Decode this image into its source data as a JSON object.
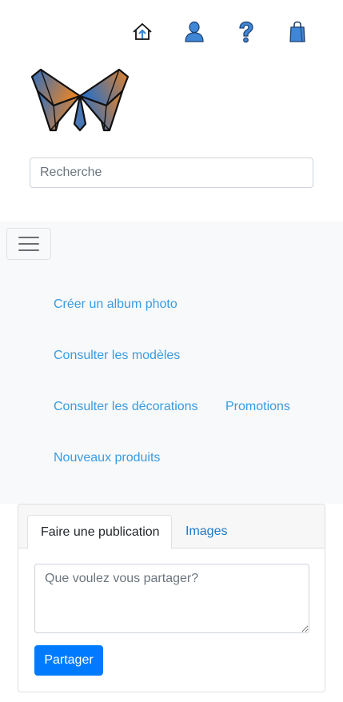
{
  "header": {
    "icons": [
      "home-upload-icon",
      "user-icon",
      "help-icon",
      "shopping-bag-icon"
    ]
  },
  "brand": {
    "logo": "butterfly-logo",
    "colors": {
      "blue": "#2f6fc0",
      "orange": "#e3832a"
    }
  },
  "search": {
    "placeholder": "Recherche",
    "value": ""
  },
  "nav": {
    "toggler_icon": "hamburger-icon",
    "items": [
      {
        "label": "Créer un album photo"
      },
      {
        "label": "Consulter les modèles"
      },
      {
        "label": "Consulter les décorations"
      },
      {
        "label": "Promotions"
      },
      {
        "label": "Nouveaux produits"
      }
    ],
    "link_color": "#3a9be0"
  },
  "composer": {
    "tabs": [
      {
        "label": "Faire une publication",
        "active": true
      },
      {
        "label": "Images",
        "active": false
      }
    ],
    "textarea_placeholder": "Que voulez vous partager?",
    "textarea_value": "",
    "submit_label": "Partager",
    "accent": "#007bff"
  }
}
